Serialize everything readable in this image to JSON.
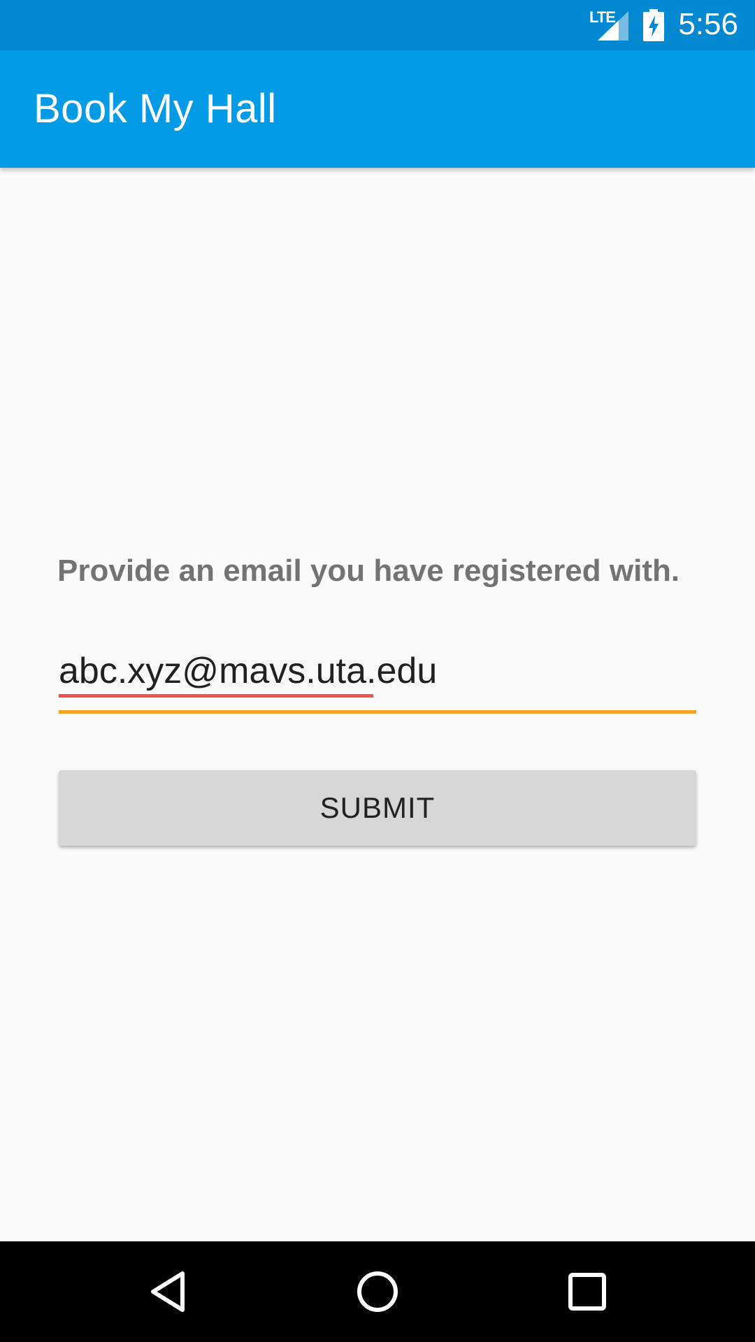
{
  "status_bar": {
    "network": "LTE",
    "time": "5:56",
    "icons": [
      "signal-icon",
      "battery-charging-icon"
    ]
  },
  "app_bar": {
    "title": "Book My Hall",
    "color": "#039be5"
  },
  "form": {
    "prompt": "Provide an email you have registered with.",
    "email_value": "abc.xyz@mavs.uta.edu",
    "submit_label": "SUBMIT"
  },
  "nav_bar": {
    "icons": [
      "back-icon",
      "home-icon",
      "recents-icon"
    ]
  },
  "colors": {
    "status_bar": "#0288d1",
    "app_bar": "#039be5",
    "input_focus_line": "#f5a524",
    "spell_check_underline": "#f0554d",
    "button_bg": "#d6d7d7"
  }
}
